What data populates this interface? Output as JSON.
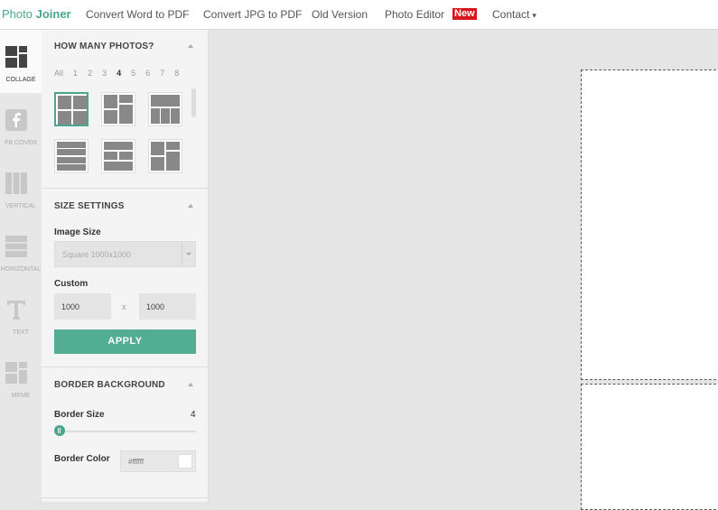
{
  "header": {
    "logo_light": "Photo ",
    "logo_bold": "Joiner",
    "nav": [
      "Convert Word to PDF",
      "Convert JPG to PDF",
      "Old Version",
      "Photo Editor",
      "Contact"
    ],
    "new_badge": "New"
  },
  "rail": {
    "items": [
      {
        "label": "COLLAGE",
        "icon": "collage-icon"
      },
      {
        "label": "FB COVER",
        "icon": "facebook-icon"
      },
      {
        "label": "VERTICAL",
        "icon": "vertical-icon"
      },
      {
        "label": "HORIZONTAL",
        "icon": "horizontal-icon"
      },
      {
        "label": "TEXT",
        "icon": "text-icon"
      },
      {
        "label": "MEME",
        "icon": "meme-icon"
      }
    ]
  },
  "photos": {
    "title": "HOW MANY PHOTOS?",
    "counts": [
      "All",
      "1",
      "2",
      "3",
      "4",
      "5",
      "6",
      "7",
      "8"
    ],
    "selected_count": "4"
  },
  "size": {
    "title": "SIZE SETTINGS",
    "image_size_label": "Image Size",
    "image_size_value": "Square 1000x1000",
    "custom_label": "Custom",
    "width": "1000",
    "x": "x",
    "height": "1000",
    "apply": "APPLY"
  },
  "border": {
    "title": "BORDER BACKGROUND",
    "size_label": "Border Size",
    "size_value": "4",
    "color_label": "Border Color",
    "color_value": "#ffffff"
  },
  "colors": {
    "accent": "#52ad93",
    "badge": "#d9161d"
  }
}
